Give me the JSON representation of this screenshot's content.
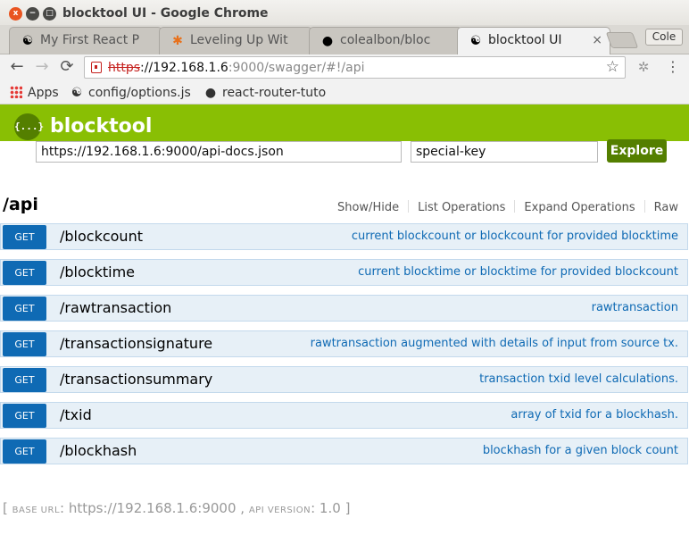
{
  "window": {
    "title": "blocktool UI - Google Chrome",
    "close_glyph": "x",
    "min_glyph": "−",
    "max_glyph": "□"
  },
  "tabs": [
    {
      "label": "My First React P",
      "icon": "yin-yang-icon",
      "close": "×"
    },
    {
      "label": "Leveling Up Wit",
      "icon": "asterisk-icon",
      "close": "×"
    },
    {
      "label": "colealbon/bloc",
      "icon": "github-icon",
      "close": "×"
    },
    {
      "label": "blocktool UI",
      "icon": "yin-yang-icon",
      "close": "×",
      "active": true
    }
  ],
  "profile": {
    "name": "Cole"
  },
  "toolbar": {
    "back": "←",
    "forward": "→",
    "reload": "⟳",
    "url_scheme": "https",
    "url_host": "://192.168.1.6",
    "url_rest": ":9000/swagger/#!/api",
    "star": "☆",
    "menu": "⋮"
  },
  "bookmarks": [
    {
      "label": "Apps",
      "icon": "apps-grid-icon"
    },
    {
      "label": "config/options.js",
      "icon": "yin-yang-icon"
    },
    {
      "label": "react-router-tuto",
      "icon": "github-icon"
    }
  ],
  "swagger": {
    "brand": "blocktool",
    "logo_glyph": "{...}",
    "spec_url": "https://192.168.1.6:9000/api-docs.json",
    "api_key": "special-key",
    "explore_label": "Explore"
  },
  "resource": {
    "name": "/api",
    "links": [
      "Show/Hide",
      "List Operations",
      "Expand Operations",
      "Raw"
    ]
  },
  "operations": [
    {
      "method": "GET",
      "path": "/blockcount",
      "summary": "current blockcount or blockcount for provided blocktime"
    },
    {
      "method": "GET",
      "path": "/blocktime",
      "summary": "current blocktime or blocktime for provided blockcount"
    },
    {
      "method": "GET",
      "path": "/rawtransaction",
      "summary": "rawtransaction"
    },
    {
      "method": "GET",
      "path": "/transactionsignature",
      "summary": "rawtransaction augmented with details of input from source tx."
    },
    {
      "method": "GET",
      "path": "/transactionsummary",
      "summary": "transaction txid level calculations."
    },
    {
      "method": "GET",
      "path": "/txid",
      "summary": "array of txid for a blockhash."
    },
    {
      "method": "GET",
      "path": "/blockhash",
      "summary": "blockhash for a given block count"
    }
  ],
  "footer": {
    "open": "[",
    "base_label": "BASE URL",
    "base_url": "https://192.168.1.6:9000",
    "version_label": "API VERSION",
    "version": "1.0",
    "close": "]"
  },
  "colors": {
    "swagger_green": "#89bf04",
    "explore_green": "#547f00",
    "get_blue": "#0f6ab4",
    "op_bg": "#e7f0f7"
  }
}
